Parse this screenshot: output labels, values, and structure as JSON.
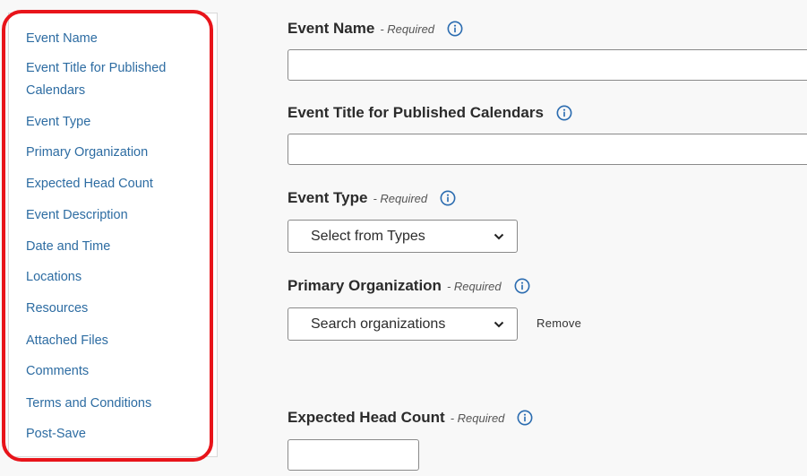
{
  "nav": {
    "items": [
      {
        "label": "Event Name"
      },
      {
        "label": "Event Title for Published"
      },
      {
        "label": "Calendars"
      },
      {
        "label": "Event Type"
      },
      {
        "label": "Primary Organization"
      },
      {
        "label": "Expected Head Count"
      },
      {
        "label": "Event Description"
      },
      {
        "label": "Date and Time"
      },
      {
        "label": "Locations"
      },
      {
        "label": "Resources"
      },
      {
        "label": "Attached Files"
      },
      {
        "label": "Comments"
      },
      {
        "label": "Terms and Conditions"
      },
      {
        "label": "Post-Save"
      }
    ]
  },
  "form": {
    "event_name": {
      "label": "Event Name",
      "required": "- Required",
      "value": ""
    },
    "event_title": {
      "label": "Event Title for Published Calendars",
      "value": ""
    },
    "event_type": {
      "label": "Event Type",
      "required": "- Required",
      "selected": "Select from Types"
    },
    "primary_org": {
      "label": "Primary Organization",
      "required": "- Required",
      "selected": "Search organizations",
      "remove_label": "Remove"
    },
    "head_count": {
      "label": "Expected Head Count",
      "required": "- Required",
      "value": ""
    }
  },
  "icons": {
    "info": "info-circle-icon",
    "chevron": "chevron-down-icon"
  },
  "colors": {
    "link": "#2d6ca2",
    "highlight": "#e8141a",
    "info_icon": "#2b6cb0"
  }
}
